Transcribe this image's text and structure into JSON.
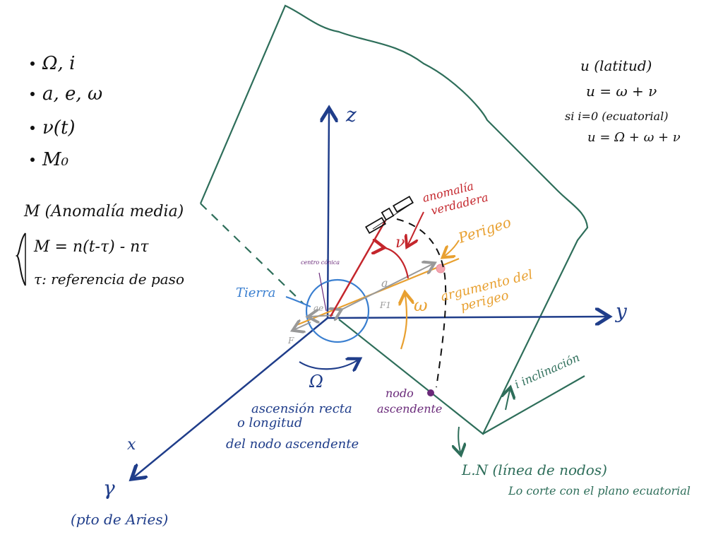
{
  "left_list": {
    "item1": "Ω, i",
    "item2": "a, e, ω",
    "item3": "ν(t)",
    "item4": "M₀"
  },
  "mean_anomaly": {
    "title": "M (Anomalía media)",
    "eq1": "M = n(t-τ) - nτ",
    "eq2": "τ: referencia de paso"
  },
  "right_notes": {
    "line1": "u (latitud)",
    "line2": "u = ω + ν",
    "line3": "si i=0 (ecuatorial)",
    "line4": "u = Ω + ω + ν"
  },
  "axes": {
    "z": "z",
    "y": "y",
    "x": "x",
    "gamma": "γ",
    "aries": "(pto de Aries)"
  },
  "labels": {
    "earth": "Tierra",
    "conic_center": "centro cónica",
    "true_anomaly_line1": "anomalía",
    "true_anomaly_line2": "verdadera",
    "nu": "ν",
    "perigee": "Perigeo",
    "a": "a",
    "ae": "ae",
    "f1": "F1",
    "f": "F",
    "omega": "ω",
    "arg_perigee_line1": "argumento del",
    "arg_perigee_line2": "perigeo",
    "Omega": "Ω",
    "raan_line1": "ascensión recta",
    "raan_line2": "o longitud",
    "raan_line3": "del nodo ascendente",
    "node_line1": "nodo",
    "node_line2": "ascendente",
    "inclination": "i inclinación",
    "line_of_nodes": "L.N (línea de nodos)",
    "line_of_nodes_sub": "Lo corte con el plano ecuatorial"
  }
}
